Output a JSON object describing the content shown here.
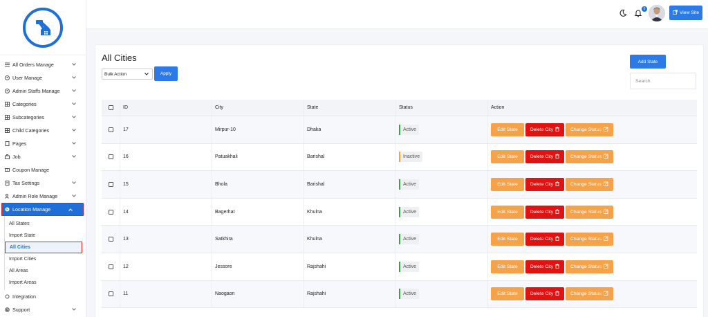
{
  "sidebar": {
    "items": [
      {
        "label": "All Orders Manage",
        "icon": "list-icon",
        "chevron": true
      },
      {
        "label": "User Manage",
        "icon": "user-circle-icon",
        "chevron": true
      },
      {
        "label": "Admin Staffs Manage",
        "icon": "user-circle-icon",
        "chevron": true
      },
      {
        "label": "Categories",
        "icon": "grid-icon",
        "chevron": true
      },
      {
        "label": "Subcategories",
        "icon": "grid-icon",
        "chevron": true
      },
      {
        "label": "Child Categories",
        "icon": "grid-icon",
        "chevron": true
      },
      {
        "label": "Pages",
        "icon": "page-icon",
        "chevron": true
      },
      {
        "label": "Job",
        "icon": "briefcase-icon",
        "chevron": true
      },
      {
        "label": "Coupon Manage",
        "icon": "coupon-icon",
        "chevron": false
      },
      {
        "label": "Tax Settings",
        "icon": "tax-icon",
        "chevron": true
      },
      {
        "label": "Admin Role Manage",
        "icon": "role-icon",
        "chevron": true
      },
      {
        "label": "Location Manage",
        "icon": "globe-icon",
        "chevron": true
      }
    ],
    "sub_items": [
      "All States",
      "Import State",
      "All Cities",
      "Import Cities",
      "All Areas",
      "Import Areas"
    ],
    "bottom_items": [
      {
        "label": "Integration",
        "icon": "integration-icon",
        "chevron": false
      },
      {
        "label": "Support",
        "icon": "support-icon",
        "chevron": true
      }
    ]
  },
  "topbar": {
    "notification_count": "0",
    "view_site_label": "View Site"
  },
  "main": {
    "title": "All Cities",
    "bulk_action_label": "Bulk Action",
    "apply_label": "Apply",
    "add_state_label": "Add State",
    "search_placeholder": "Search",
    "columns": [
      "ID",
      "City",
      "State",
      "Status",
      "Action"
    ],
    "rows": [
      {
        "id": "17",
        "city": "Mirpur-10",
        "state": "Dhaka",
        "status": "Active"
      },
      {
        "id": "16",
        "city": "Patuakhali",
        "state": "Barishal",
        "status": "Inactive"
      },
      {
        "id": "15",
        "city": "Bhola",
        "state": "Barishal",
        "status": "Active"
      },
      {
        "id": "14",
        "city": "Bagerhat",
        "state": "Khulna",
        "status": "Active"
      },
      {
        "id": "13",
        "city": "Satkhira",
        "state": "Khulna",
        "status": "Active"
      },
      {
        "id": "12",
        "city": "Jessore",
        "state": "Rajshahi",
        "status": "Active"
      },
      {
        "id": "11",
        "city": "Naogaon",
        "state": "Rajshahi",
        "status": "Active"
      }
    ],
    "actions": {
      "edit": "Edit State",
      "delete": "Delete City",
      "change": "Change Status"
    }
  },
  "colors": {
    "primary": "#1f6fd8",
    "button_blue": "#2b7ae8",
    "orange": "#f5a34a",
    "danger": "#e01313",
    "highlight_border": "#e21c1c"
  }
}
